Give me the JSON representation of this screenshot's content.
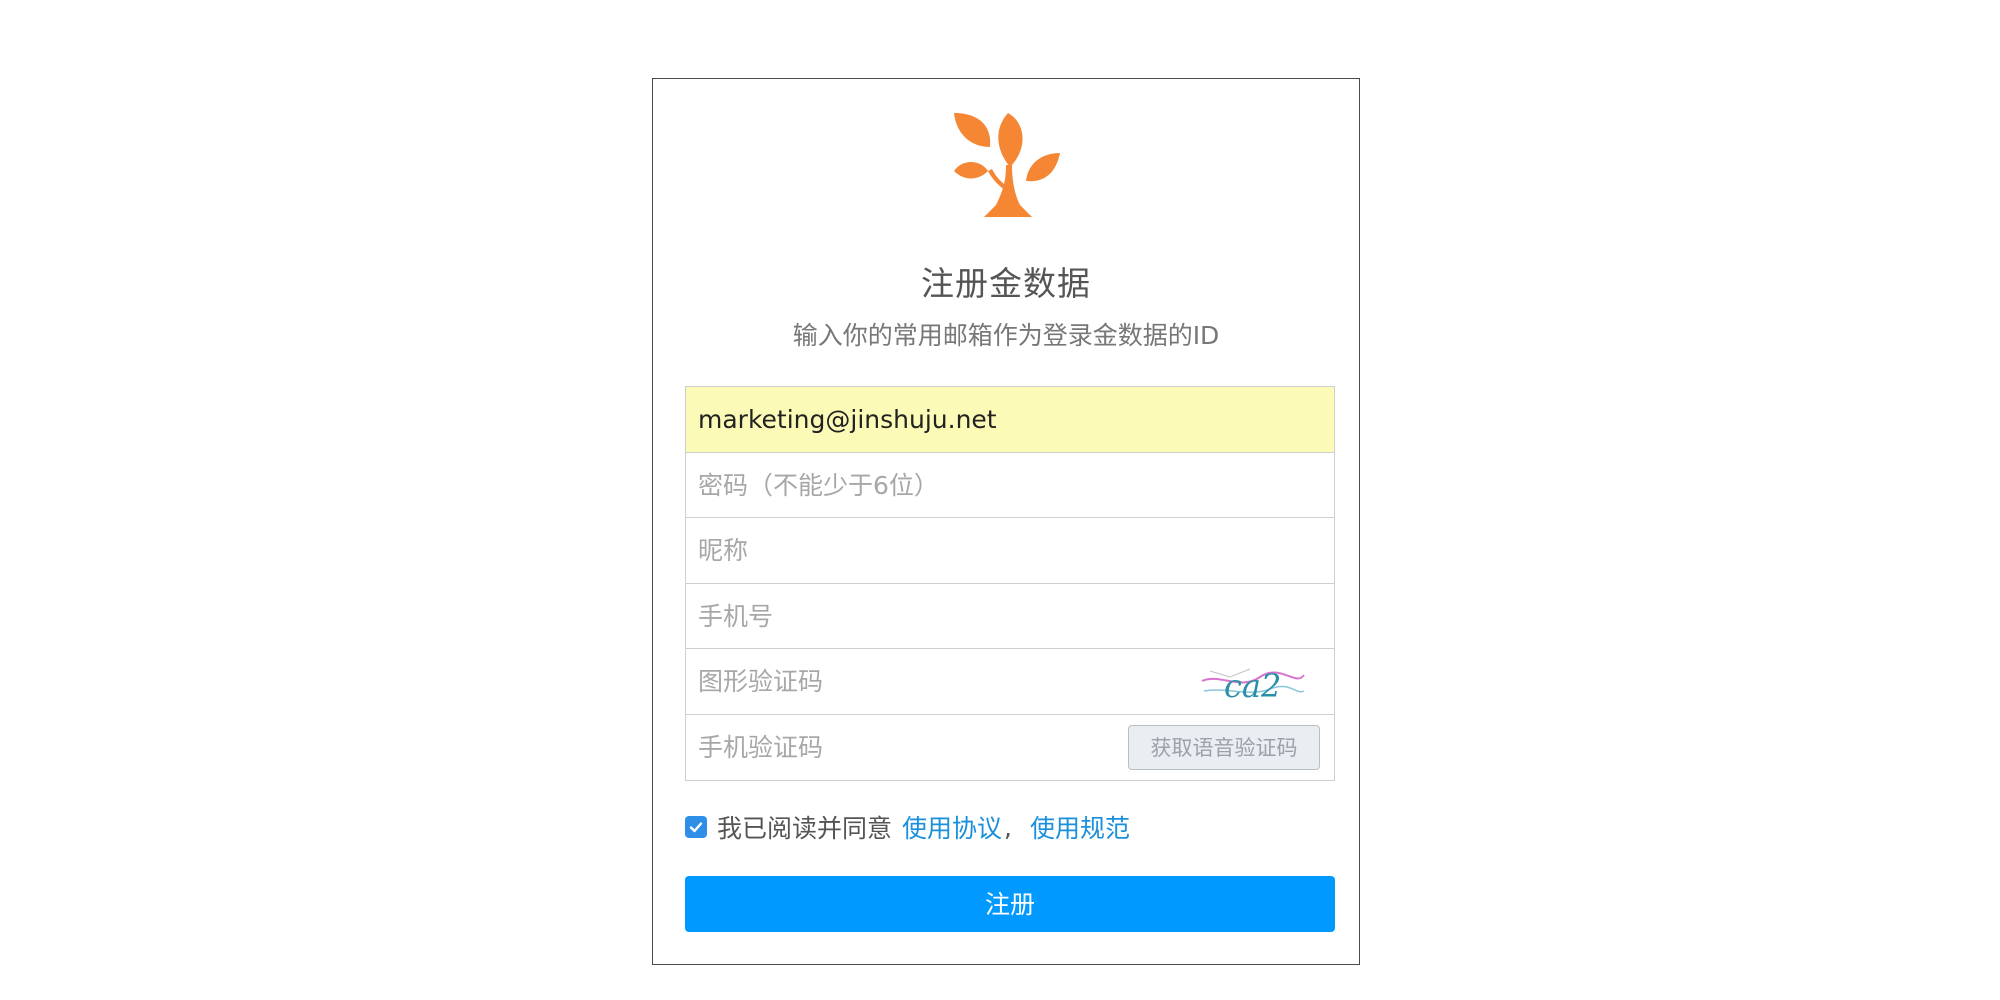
{
  "header": {
    "title": "注册金数据",
    "subtitle": "输入你的常用邮箱作为登录金数据的ID",
    "logo_icon": "tree-leaves-icon",
    "logo_color": "#f58634"
  },
  "form": {
    "email": {
      "value": "marketing@jinshuju.net",
      "placeholder": ""
    },
    "password": {
      "placeholder": "密码（不能少于6位）"
    },
    "nickname": {
      "placeholder": "昵称"
    },
    "phone": {
      "placeholder": "手机号"
    },
    "captcha": {
      "placeholder": "图形验证码",
      "image_text": "ca2"
    },
    "sms_code": {
      "placeholder": "手机验证码",
      "voice_button_label": "获取语音验证码"
    }
  },
  "agreement": {
    "checked": true,
    "text": "我已阅读并同意",
    "link1": "使用协议",
    "separator": ",",
    "link2": "使用规范"
  },
  "submit": {
    "label": "注册"
  },
  "colors": {
    "accent": "#0099ff",
    "link": "#1a8fdc",
    "autofill_bg": "#fbfbb7"
  }
}
